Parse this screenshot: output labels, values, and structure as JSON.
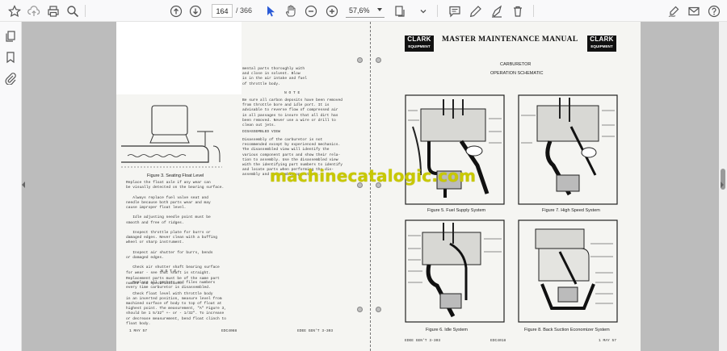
{
  "toolbar": {
    "page_current": "164",
    "page_total": "/ 366",
    "zoom": "57,6%"
  },
  "left_page": {
    "section_fragment": "mental parts thoroughly with\nand close in solvent. Blow\nis in the air intake and fuel\nof throttle body.",
    "note_heading": "N O T E",
    "note_text": "Be sure all carbon deposits have been removed\nfrom throttle bore and idle port. It is\nadvisable to reverse flow of compressed air\nin all passages to insure that all dirt has\nbeen removed. Never use a wire or drill to\nclean out jets.",
    "disassembled_heading": "DISASSEMBLED VIEW",
    "disassembled_text": "Disassembly of the carburetor is not\nrecommended except by experienced mechanics.\nThe disassembled view will identify the\nvarious component parts and show their rela-\ntion to assembly. Use the disassembled view\nwith the identifying part numbers to identify\nand locate parts when performing the dis-\nassembly and reassembly operations.",
    "figure_caption": "Figure 3. Seating Float Level",
    "body_text": "Replace the float axle if any wear can\nbe visually detected on the bearing surface.\n\n   Always replace fuel valve seat and\nneedle because both parts wear and may\ncause improper float level.\n\n   Idle adjusting needle point must be\nsmooth and free of ridges.\n\n   Inspect throttle plate for burrs or\ndamaged edges. Never clean with a buffing\nwheel or sharp instrument.\n\n   Inspect air shutter for burrs, bends\nor damaged edges.\n\n   Check air shutter shaft bearing surface\nfor wear - see that shaft is straight.\n\n   Replace all gaskets and files numbers\nevery time carburetor is disassembled.",
    "note2_heading": "N O T E",
    "note2_text": "Replacement parts must be of the same part\nnumber and specifications.\n\n   Check float level with throttle body\nin an inverted position, measure level from\nmachined surface of body to top of float at\nhighest point. The measurement, \"A\" Figure 3,\nshould be 1 5/32\" +- or - 1/32\". To increase\nor decrease measurement, bend float clinch to\nfloat body.",
    "footer_left": "1 MAY 57",
    "footer_mid": "EDC4088",
    "footer_right": "EDEE GEN'T 3-303"
  },
  "right_page": {
    "header_title": "MASTER MAINTENANCE MANUAL",
    "logo_line1": "CLARK",
    "logo_line2": "EQUIPMENT",
    "subtitle": "CARBURETOR",
    "subtitle2": "OPERATION SCHEMATIC",
    "fig5": "Figure 5.  Fuel Supply System",
    "fig7": "Figure 7.  High Speed System",
    "fig6": "Figure 6.  Idle System",
    "fig8": "Figure 8.  Back Suction Economizer System",
    "footer_left": "EDEE GEN'T 3-303",
    "footer_mid": "EDC4018",
    "footer_right": "1 MAY 57"
  },
  "watermark": "machinecatalogic.com",
  "icons": [
    "bookmark-star-icon",
    "upload-icon",
    "print-icon",
    "zoom-search-icon",
    "arrow-up-icon",
    "arrow-down-icon",
    "pointer-icon",
    "hand-icon",
    "zoom-out-icon",
    "zoom-in-icon",
    "page-fit-icon",
    "comment-icon",
    "pen-icon",
    "highlight-icon",
    "delete-icon",
    "pages-panel-icon",
    "bookmark-panel-icon",
    "attachment-icon",
    "sign-icon",
    "mail-icon",
    "help-icon"
  ]
}
